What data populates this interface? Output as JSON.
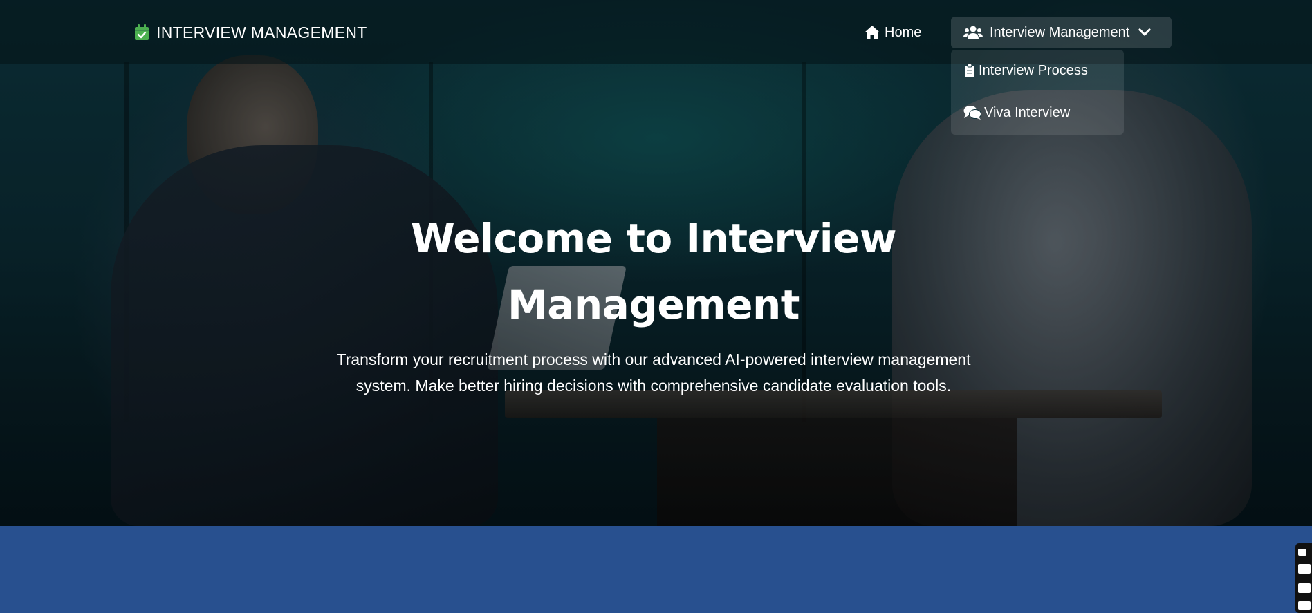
{
  "navbar": {
    "brand": "INTERVIEW MANAGEMENT",
    "home_label": "Home",
    "dropdown_label": "Interview Management",
    "dropdown_items": [
      {
        "label": "Interview Process",
        "icon": "clipboard-icon"
      },
      {
        "label": "Viva Interview",
        "icon": "comments-icon"
      }
    ]
  },
  "hero": {
    "title": "Welcome to Interview Management",
    "subtitle": "Transform your recruitment process with our advanced AI-powered interview management system. Make better hiring decisions with comprehensive candidate evaluation tools."
  },
  "colors": {
    "brand_icon": "#4caf50",
    "band": "#28508f",
    "text": "#ffffff"
  },
  "icons": {
    "brand": "calendar-check-icon",
    "home": "home-icon",
    "dropdown": "users-icon",
    "chevron": "chevron-down-icon"
  }
}
